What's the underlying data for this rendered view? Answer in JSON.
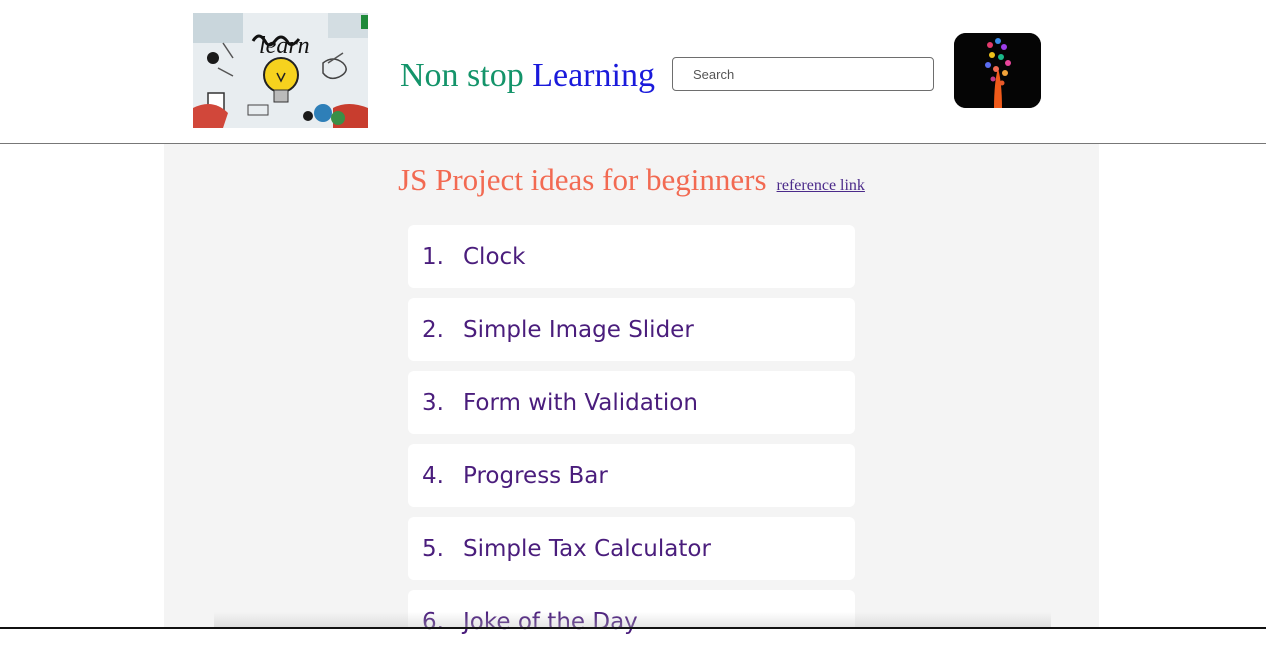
{
  "header": {
    "logo_alt": "learn",
    "brand_word1": "Non stop",
    "brand_word2": "Learning",
    "search_placeholder": "Search",
    "colors": {
      "brand_word1": "#14946a",
      "brand_word2": "#1a1adb"
    }
  },
  "main": {
    "title": "JS Project ideas for beginners",
    "reference_link": "reference link",
    "colors": {
      "title": "#f26a52",
      "item_text": "#4a1d7c"
    },
    "items": [
      {
        "number": "1.",
        "label": "Clock"
      },
      {
        "number": "2.",
        "label": "Simple Image Slider"
      },
      {
        "number": "3.",
        "label": "Form with Validation"
      },
      {
        "number": "4.",
        "label": "Progress Bar"
      },
      {
        "number": "5.",
        "label": "Simple Tax Calculator"
      },
      {
        "number": "6.",
        "label": "Joke of the Day"
      }
    ]
  }
}
